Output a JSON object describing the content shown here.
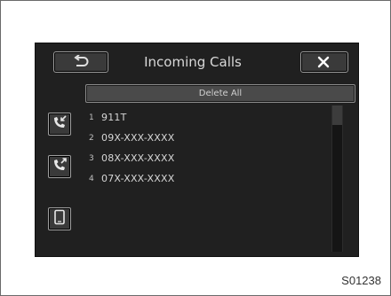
{
  "header": {
    "title": "Incoming Calls",
    "back_icon": "return-arrow-icon",
    "close_icon": "close-x-icon"
  },
  "toolbar": {
    "delete_all_label": "Delete All"
  },
  "side_buttons": [
    {
      "icon": "incoming-call-icon"
    },
    {
      "icon": "outgoing-call-icon"
    },
    {
      "icon": "phone-device-icon"
    }
  ],
  "calls": [
    {
      "index": "1",
      "number": "911T"
    },
    {
      "index": "2",
      "number": "09X-XXX-XXXX"
    },
    {
      "index": "3",
      "number": "08X-XXX-XXXX"
    },
    {
      "index": "4",
      "number": "07X-XXX-XXXX"
    }
  ],
  "figure_code": "S01238",
  "colors": {
    "screen_bg": "#202020",
    "text": "#d6d6d6",
    "button_border": "#9a9a9a"
  }
}
